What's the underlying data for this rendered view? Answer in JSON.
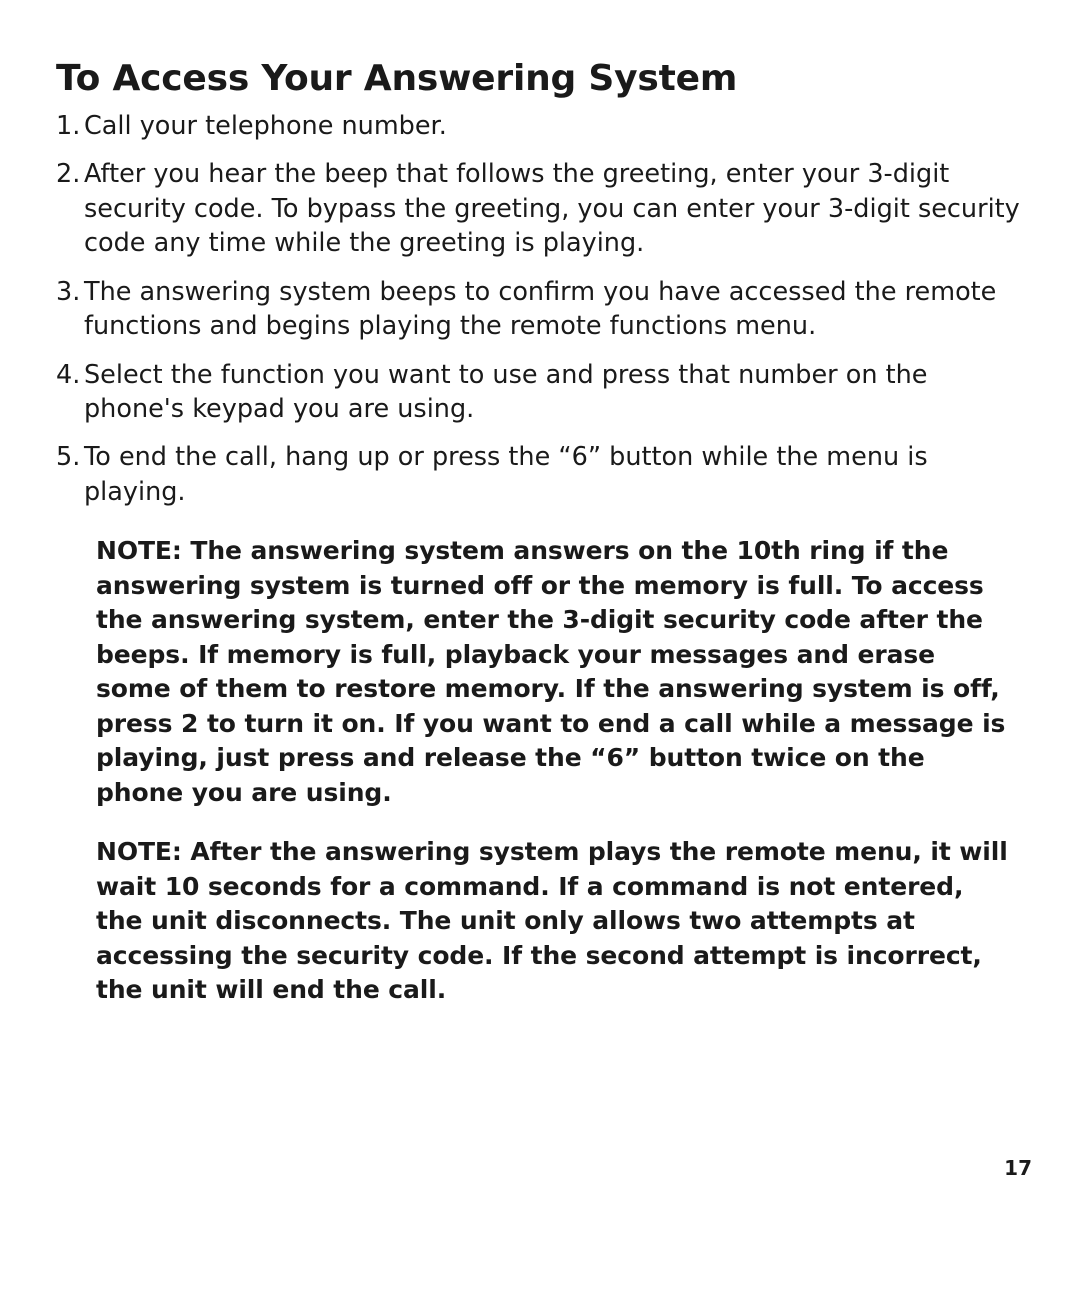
{
  "heading": "To Access Your Answering System",
  "steps": [
    "Call your telephone number.",
    "After you hear the beep that follows the greeting, enter your 3-digit security code. To bypass the greeting, you can enter your 3-digit security code any time while the greeting is playing.",
    "The answering system beeps to confirm you have accessed the remote functions and begins playing the remote functions menu.",
    "Select the function you want to use and press that number on the phone's keypad you are using.",
    "To end the call, hang up or press the “6” button while the menu is playing."
  ],
  "notes": [
    "NOTE: The answering system answers on the 10th ring if the answering system is turned off or the memory is full. To access the answering system, enter the 3-digit security code after the beeps. If memory is full, playback your messages and erase some of them to restore memory. If the answering system is off, press 2 to turn it on. If you want to end a call while a message is playing, just press and release the “6” button twice on the phone you are using.",
    "NOTE: After the answering system plays the remote menu, it will wait 10 seconds for a command. If a command is not entered, the unit disconnects. The unit only allows two attempts at accessing the security code. If the second attempt is incorrect, the unit will end the call."
  ],
  "nums": {
    "n1": "1.",
    "n2": "2.",
    "n3": "3.",
    "n4": "4.",
    "n5": "5."
  },
  "page_number": "17"
}
